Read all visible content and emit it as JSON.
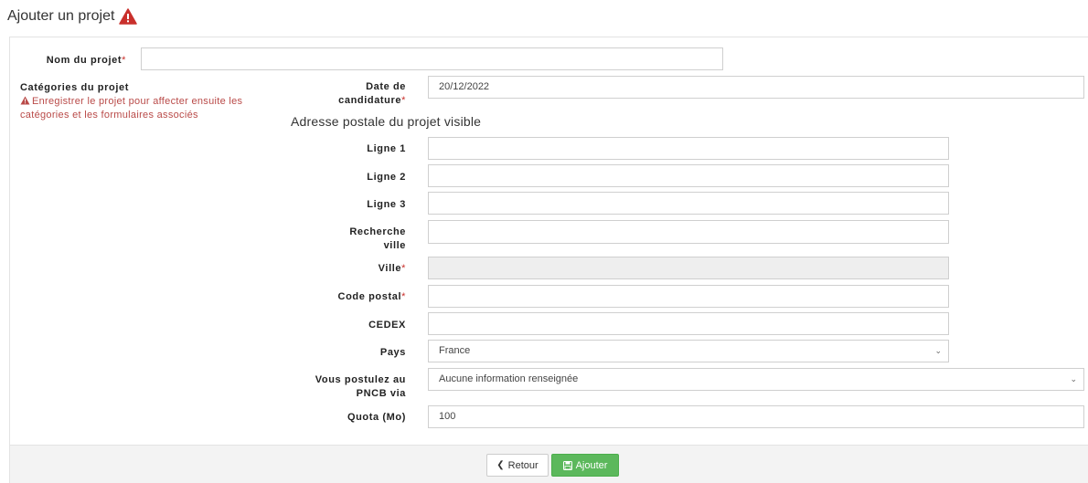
{
  "header": {
    "title": "Ajouter un projet",
    "warning_icon": "warning-triangle-icon",
    "warning_color": "#c9302c"
  },
  "form": {
    "project_name": {
      "label": "Nom du projet",
      "required_mark": "*",
      "value": ""
    },
    "categories": {
      "title": "Catégories du projet",
      "message": "Enregistrer le projet pour affecter ensuite les catégories et les formulaires associés"
    },
    "date": {
      "label_line1": "Date de",
      "label_line2": "candidature",
      "required_mark": "*",
      "value": "20/12/2022"
    },
    "address_section_title": "Adresse postale du projet visible",
    "line1": {
      "label": "Ligne 1",
      "value": ""
    },
    "line2": {
      "label": "Ligne 2",
      "value": ""
    },
    "line3": {
      "label": "Ligne 3",
      "value": ""
    },
    "city_search": {
      "label_line1": "Recherche",
      "label_line2": "ville",
      "value": ""
    },
    "city": {
      "label": "Ville",
      "required_mark": "*",
      "value": ""
    },
    "postal_code": {
      "label": "Code postal",
      "required_mark": "*",
      "value": ""
    },
    "cedex": {
      "label": "CEDEX",
      "value": ""
    },
    "country": {
      "label": "Pays",
      "value": "France"
    },
    "applying_via": {
      "label_line1": "Vous postulez au",
      "label_line2": "PNCB via",
      "value": "Aucune information renseignée"
    },
    "quota": {
      "label": "Quota (Mo)",
      "value": "100"
    }
  },
  "footer": {
    "back_label": "Retour",
    "add_label": "Ajouter",
    "add_color": "#5cb85c"
  }
}
